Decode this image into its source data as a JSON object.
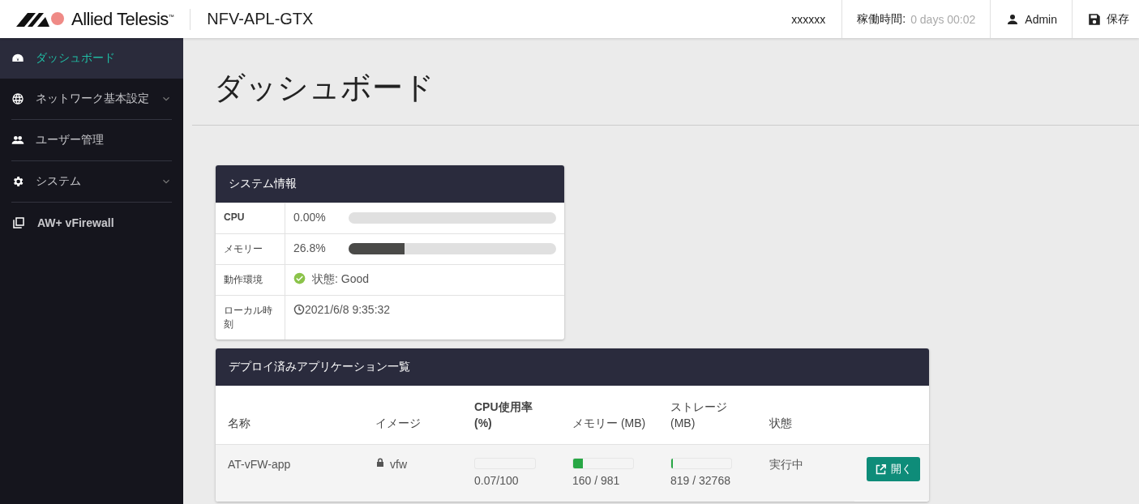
{
  "header": {
    "logo": "Allied Telesis",
    "logo_mark": "™",
    "product": "NFV-APL-GTX",
    "host": "xxxxxx",
    "uptime_label": "稼働時間:",
    "uptime_value": "0 days 00:02",
    "user": "Admin",
    "save": "保存"
  },
  "sidebar": {
    "items": [
      {
        "kind": "dashboard",
        "label": "ダッシュボード",
        "selected": true,
        "submenu": false
      },
      {
        "kind": "network",
        "label": "ネットワーク基本設定",
        "selected": false,
        "submenu": true
      },
      {
        "kind": "users",
        "label": "ユーザー管理",
        "selected": false,
        "submenu": false
      },
      {
        "kind": "system",
        "label": "システム",
        "selected": false,
        "submenu": true
      },
      {
        "kind": "app",
        "label": "AW+ vFirewall",
        "selected": false,
        "submenu": false
      }
    ]
  },
  "page": {
    "title": "ダッシュボード"
  },
  "system_info": {
    "title": "システム情報",
    "rows": [
      {
        "kind": "meter",
        "label": "CPU",
        "value": "0.00%",
        "level": 0
      },
      {
        "kind": "meter",
        "label": "メモリー",
        "value": "26.8%",
        "level": 0.268
      },
      {
        "kind": "status",
        "label": "動作環境",
        "value": "状態: Good"
      },
      {
        "kind": "time",
        "label": "ローカル時刻",
        "value": "2021/6/8 9:35:32"
      }
    ]
  },
  "apps": {
    "title": "デプロイ済みアプリケーション一覧",
    "columns": [
      "名称",
      "イメージ",
      "CPU使用率 (%)",
      "メモリー (MB)",
      "ストレージ (MB)",
      "状態"
    ],
    "rows": [
      {
        "name": "AT-vFW-app",
        "image": "vfw",
        "cpu": {
          "text": "0.07/100",
          "level": 0.0007
        },
        "memory": {
          "text": "160 / 981",
          "level": 0.163
        },
        "storage": {
          "text": "819 / 32768",
          "level": 0.025
        },
        "status": "実行中",
        "action": "開く"
      }
    ]
  }
}
